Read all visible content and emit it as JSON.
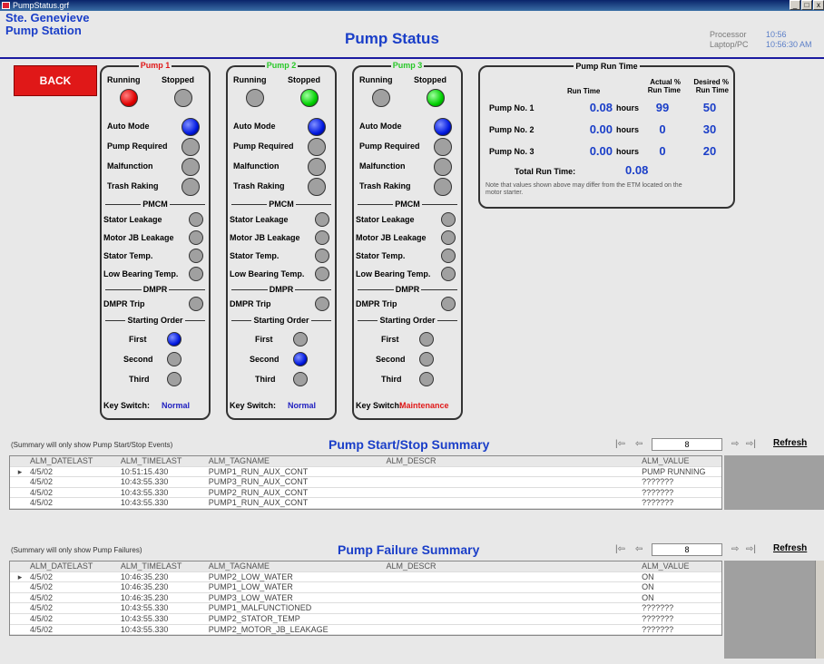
{
  "window": {
    "title": "PumpStatus.grf",
    "min": "_",
    "max": "□",
    "close": "x"
  },
  "station": {
    "line1": "Ste. Genevieve",
    "line2": "Pump Station"
  },
  "page_title": "Pump Status",
  "proc": {
    "label1": "Processor",
    "val1": "10:56",
    "label2": "Laptop/PC",
    "val2": "10:56:30 AM"
  },
  "back_label": "BACK",
  "pumps": [
    {
      "title": "Pump 1",
      "title_color": "#e01818",
      "running": "red",
      "stopped": "grey",
      "auto": "blue",
      "required": "grey",
      "malfunction": "grey",
      "trash": "grey",
      "stator_leak": "grey",
      "motor_leak": "grey",
      "stator_temp": "grey",
      "low_bearing": "grey",
      "dmpr": "grey",
      "first": "blue",
      "second": "grey",
      "third": "grey",
      "key": "Normal",
      "key_color": "#2020c0"
    },
    {
      "title": "Pump 2",
      "title_color": "#28c828",
      "running": "grey",
      "stopped": "green",
      "auto": "blue",
      "required": "grey",
      "malfunction": "grey",
      "trash": "grey",
      "stator_leak": "grey",
      "motor_leak": "grey",
      "stator_temp": "grey",
      "low_bearing": "grey",
      "dmpr": "grey",
      "first": "grey",
      "second": "blue",
      "third": "grey",
      "key": "Normal",
      "key_color": "#2020c0"
    },
    {
      "title": "Pump 3",
      "title_color": "#28c828",
      "running": "grey",
      "stopped": "green",
      "auto": "blue",
      "required": "grey",
      "malfunction": "grey",
      "trash": "grey",
      "stator_leak": "grey",
      "motor_leak": "grey",
      "stator_temp": "grey",
      "low_bearing": "grey",
      "dmpr": "grey",
      "first": "grey",
      "second": "grey",
      "third": "grey",
      "key": "Maintenance",
      "key_color": "#e01818"
    }
  ],
  "labels": {
    "running": "Running",
    "stopped": "Stopped",
    "auto": "Auto Mode",
    "required": "Pump Required",
    "malfunction": "Malfunction",
    "trash": "Trash Raking",
    "pmcm": "PMCM",
    "stator_leak": "Stator Leakage",
    "motor_leak": "Motor JB Leakage",
    "stator_temp": "Stator Temp.",
    "low_bearing": "Low Bearing Temp.",
    "dmpr": "DMPR",
    "dmpr_trip": "DMPR Trip",
    "starting": "Starting Order",
    "first": "First",
    "second": "Second",
    "third": "Third",
    "key": "Key Switch:"
  },
  "runtime": {
    "title": "Pump Run Time",
    "col_run": "Run Time",
    "col_actual": "Actual % Run Time",
    "col_desired": "Desired % Run Time",
    "rows": [
      {
        "name": "Pump No. 1",
        "value": "0.08",
        "unit": "hours",
        "actual": "99",
        "desired": "50"
      },
      {
        "name": "Pump No. 2",
        "value": "0.00",
        "unit": "hours",
        "actual": "0",
        "desired": "30"
      },
      {
        "name": "Pump No. 3",
        "value": "0.00",
        "unit": "hours",
        "actual": "0",
        "desired": "20"
      }
    ],
    "total_label": "Total Run Time:",
    "total": "0.08",
    "note": "Note that values shown above may differ from the ETM located on the motor starter."
  },
  "startstop": {
    "note": "(Summary will only show Pump Start/Stop Events)",
    "title": "Pump Start/Stop Summary",
    "count": "8",
    "refresh": "Refresh",
    "headers": [
      "ALM_DATELAST",
      "ALM_TIMELAST",
      "ALM_TAGNAME",
      "ALM_DESCR",
      "ALM_VALUE"
    ],
    "rows": [
      [
        "4/5/02",
        "10:51:15.430",
        "PUMP1_RUN_AUX_CONT",
        "",
        "PUMP RUNNING"
      ],
      [
        "4/5/02",
        "10:43:55.330",
        "PUMP3_RUN_AUX_CONT",
        "",
        "???????"
      ],
      [
        "4/5/02",
        "10:43:55.330",
        "PUMP2_RUN_AUX_CONT",
        "",
        "???????"
      ],
      [
        "4/5/02",
        "10:43:55.330",
        "PUMP1_RUN_AUX_CONT",
        "",
        "???????"
      ]
    ]
  },
  "failure": {
    "note": "(Summary will only show Pump Failures)",
    "title": "Pump Failure Summary",
    "count": "8",
    "refresh": "Refresh",
    "headers": [
      "ALM_DATELAST",
      "ALM_TIMELAST",
      "ALM_TAGNAME",
      "ALM_DESCR",
      "ALM_VALUE"
    ],
    "rows": [
      [
        "4/5/02",
        "10:46:35.230",
        "PUMP2_LOW_WATER",
        "",
        "ON"
      ],
      [
        "4/5/02",
        "10:46:35.230",
        "PUMP1_LOW_WATER",
        "",
        "ON"
      ],
      [
        "4/5/02",
        "10:46:35.230",
        "PUMP3_LOW_WATER",
        "",
        "ON"
      ],
      [
        "4/5/02",
        "10:43:55.330",
        "PUMP1_MALFUNCTIONED",
        "",
        "???????"
      ],
      [
        "4/5/02",
        "10:43:55.330",
        "PUMP2_STATOR_TEMP",
        "",
        "???????"
      ],
      [
        "4/5/02",
        "10:43:55.330",
        "PUMP2_MOTOR_JB_LEAKAGE",
        "",
        "???????"
      ]
    ]
  }
}
